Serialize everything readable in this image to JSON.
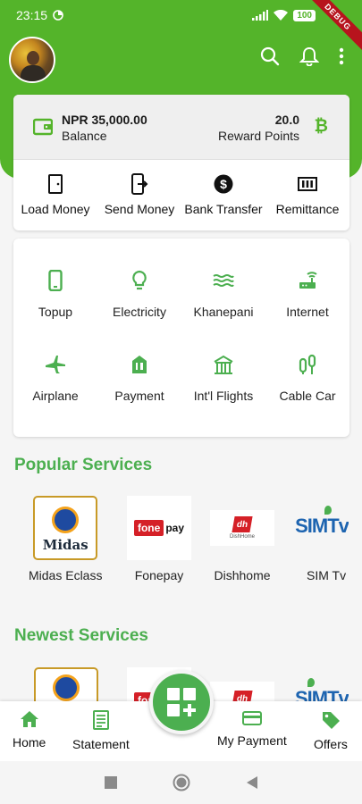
{
  "colors": {
    "primary": "#54b42a",
    "accent_text": "#4caf50"
  },
  "status_bar": {
    "time": "23:15",
    "battery": "100",
    "debug_banner": "DEBUG"
  },
  "header": {
    "icons": [
      "search-icon",
      "bell-icon",
      "more-vert-icon"
    ]
  },
  "balance": {
    "amount": "NPR 35,000.00",
    "label": "Balance",
    "reward_value": "20.0",
    "reward_label": "Reward Points",
    "reward_icon": "bitcoin-icon"
  },
  "quick_actions": [
    {
      "label": "Load Money",
      "icon": "door-icon"
    },
    {
      "label": "Send Money",
      "icon": "phone-send-icon"
    },
    {
      "label": "Bank Transfer",
      "icon": "dollar-circle-icon"
    },
    {
      "label": "Remittance",
      "icon": "cash-icon"
    }
  ],
  "services": [
    {
      "label": "Topup",
      "icon": "phone-icon"
    },
    {
      "label": "Electricity",
      "icon": "bulb-icon"
    },
    {
      "label": "Khanepani",
      "icon": "water-icon"
    },
    {
      "label": "Internet",
      "icon": "router-icon"
    },
    {
      "label": "Airplane",
      "icon": "airplane-icon"
    },
    {
      "label": "Payment",
      "icon": "payment-icon"
    },
    {
      "label": "Int'l Flights",
      "icon": "building-icon"
    },
    {
      "label": "Cable Car",
      "icon": "cable-car-icon"
    }
  ],
  "popular": {
    "title": "Popular Services",
    "items": [
      {
        "label": "Midas Eclass",
        "logo_text": "Midas"
      },
      {
        "label": "Fonepay",
        "logo_text": "fone pay"
      },
      {
        "label": "Dishhome",
        "logo_text": "DishHome"
      },
      {
        "label": "SIM Tv",
        "logo_text": "SIMTv"
      }
    ]
  },
  "newest": {
    "title": "Newest Services"
  },
  "bottom_nav": [
    {
      "label": "Home",
      "icon": "home-icon"
    },
    {
      "label": "Statement",
      "icon": "statement-icon"
    },
    {
      "label": "My Payment",
      "icon": "card-icon"
    },
    {
      "label": "Offers",
      "icon": "tag-icon"
    }
  ],
  "fab": {
    "icon": "grid-plus-icon"
  }
}
